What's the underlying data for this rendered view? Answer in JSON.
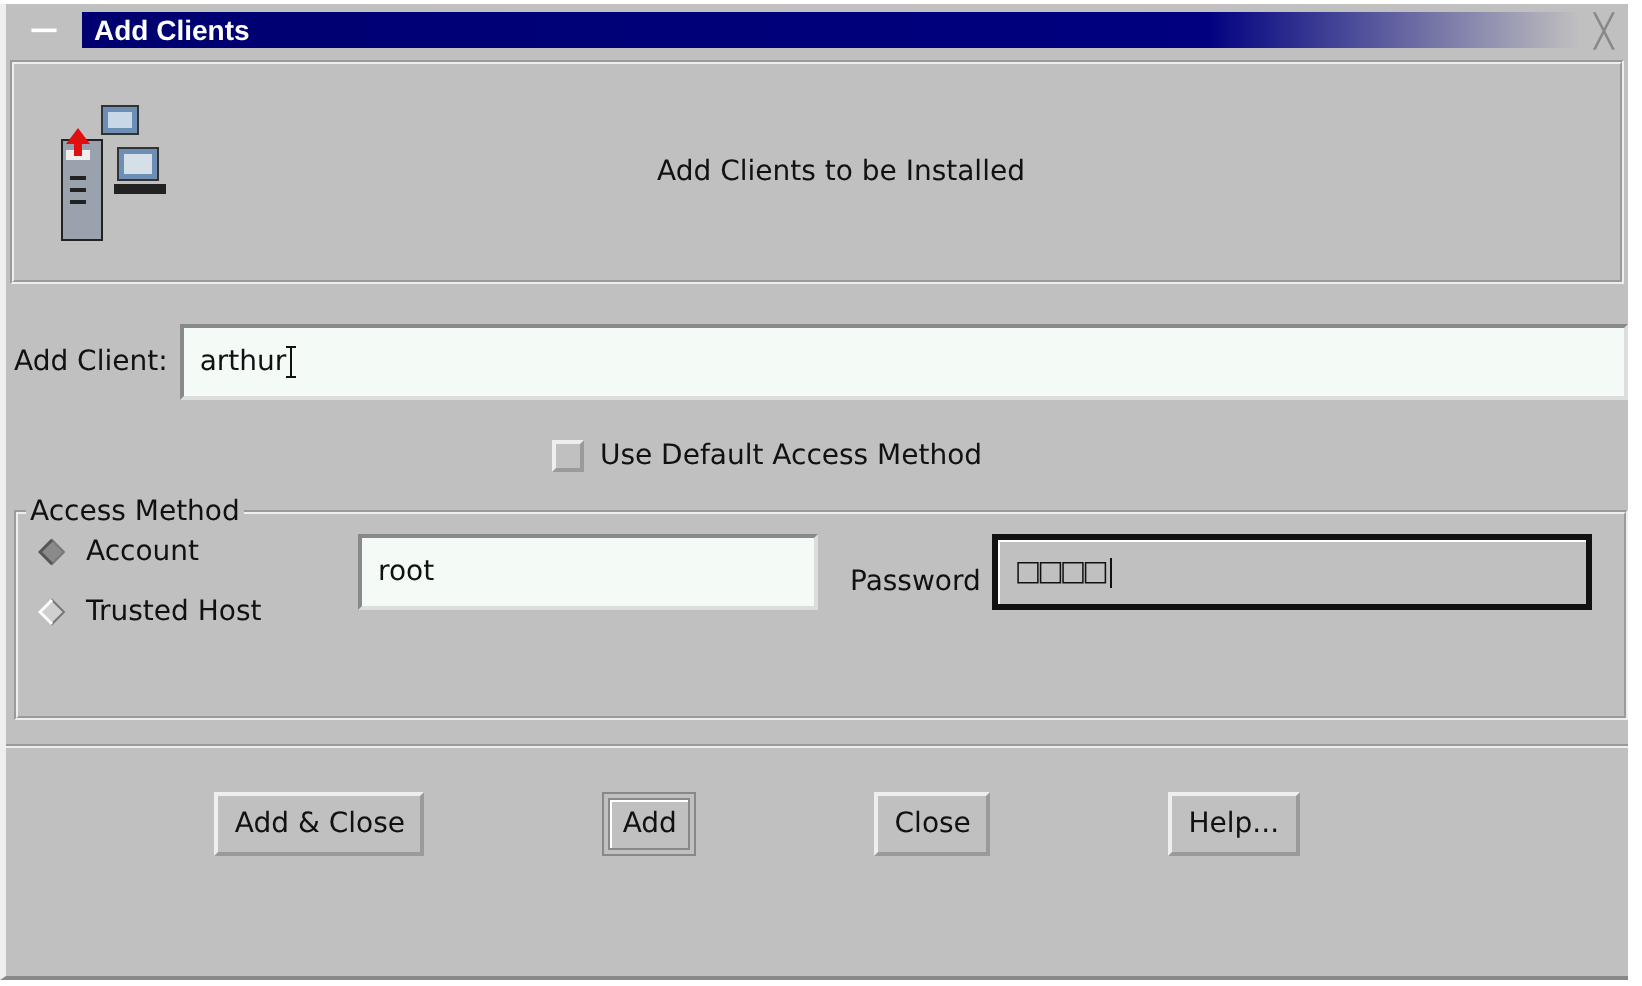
{
  "window": {
    "title": "Add Clients",
    "menu_glyph": "—",
    "close_glyph": "╳"
  },
  "header": {
    "text": "Add Clients to be Installed"
  },
  "add_client": {
    "label": "Add Client:",
    "value": "arthur"
  },
  "use_default": {
    "label": "Use Default Access Method",
    "checked": false
  },
  "access_method": {
    "title": "Access Method",
    "options": [
      {
        "label": "Account",
        "selected": true
      },
      {
        "label": "Trusted Host",
        "selected": false
      }
    ],
    "account_value": "root",
    "password_label": "Password",
    "password_value": "□□□□"
  },
  "buttons": [
    {
      "label": "Add & Close",
      "default": false
    },
    {
      "label": "Add",
      "default": true
    },
    {
      "label": "Close",
      "default": false
    },
    {
      "label": "Help...",
      "default": false
    }
  ]
}
